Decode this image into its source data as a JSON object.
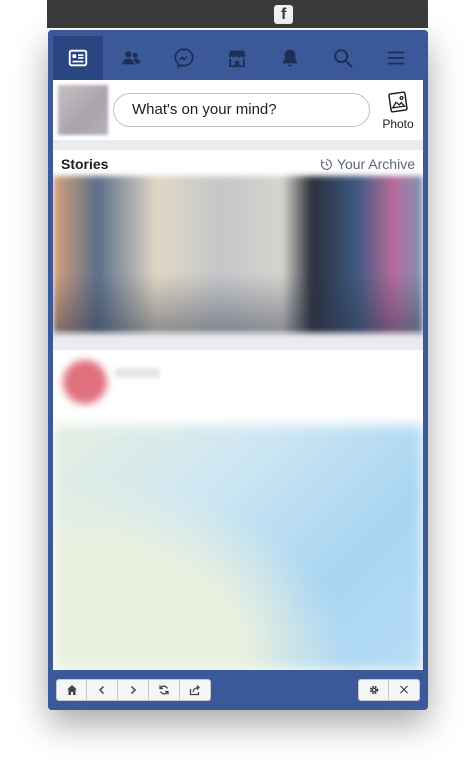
{
  "composer": {
    "placeholder": "What's on your mind?",
    "photo_label": "Photo"
  },
  "stories": {
    "title": "Stories",
    "archive_label": "Your Archive"
  },
  "nav": {
    "items": [
      {
        "name": "news-feed",
        "icon": "news-feed-icon",
        "active": true
      },
      {
        "name": "friends",
        "icon": "friends-icon",
        "active": false
      },
      {
        "name": "messenger",
        "icon": "messenger-icon",
        "active": false
      },
      {
        "name": "marketplace",
        "icon": "marketplace-icon",
        "active": false
      },
      {
        "name": "notifications",
        "icon": "bell-icon",
        "active": false
      },
      {
        "name": "search",
        "icon": "search-icon",
        "active": false
      },
      {
        "name": "menu",
        "icon": "hamburger-icon",
        "active": false
      }
    ]
  },
  "toolbar": {
    "left_buttons": [
      "home-icon",
      "back-icon",
      "forward-icon",
      "reload-icon",
      "share-icon"
    ],
    "right_buttons": [
      "gear-icon",
      "close-icon"
    ],
    "close_label": "×"
  },
  "colors": {
    "brand": "#3b5998",
    "active_tab": "#2a4680",
    "feed_background": "#e9ebee"
  }
}
